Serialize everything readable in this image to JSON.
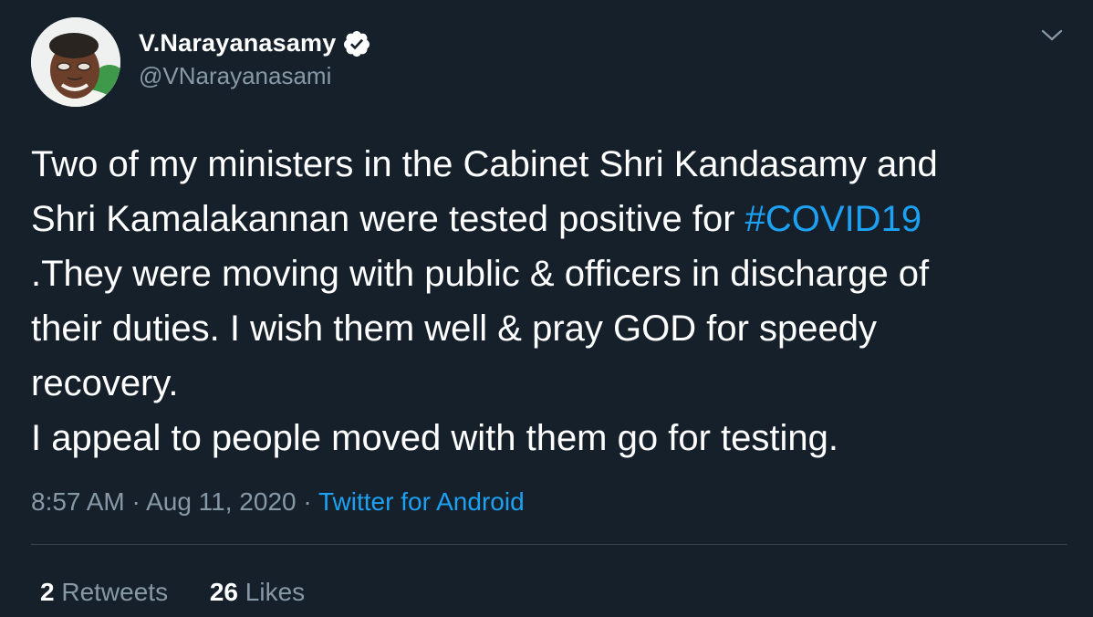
{
  "tweet": {
    "author": {
      "display_name": "V.Narayanasamy",
      "handle": "@VNarayanasami",
      "verified_icon": "verified-badge-icon"
    },
    "menu_icon": "chevron-down-icon",
    "text_lines": [
      {
        "text": "Two of my ministers in the Cabinet Shri Kandasamy and"
      },
      {
        "text": "Shri Kamalakannan were tested positive for ",
        "hashtag": "#COVID19"
      },
      {
        "text": ".They were moving with public & officers in discharge of"
      },
      {
        "text": "their duties. I wish them well & pray GOD for speedy"
      },
      {
        "text": "recovery."
      },
      {
        "text": "I appeal to people moved with them go for testing."
      }
    ],
    "time": "8:57 AM",
    "separator": "·",
    "date": "Aug 11, 2020",
    "source": "Twitter for Android",
    "retweets": {
      "count": "2",
      "label": "Retweets"
    },
    "likes": {
      "count": "26",
      "label": "Likes"
    }
  },
  "colors": {
    "background": "#15202b",
    "text": "#ffffff",
    "secondary": "#8899a6",
    "accent": "#1da1f2",
    "divider": "#38444d"
  }
}
